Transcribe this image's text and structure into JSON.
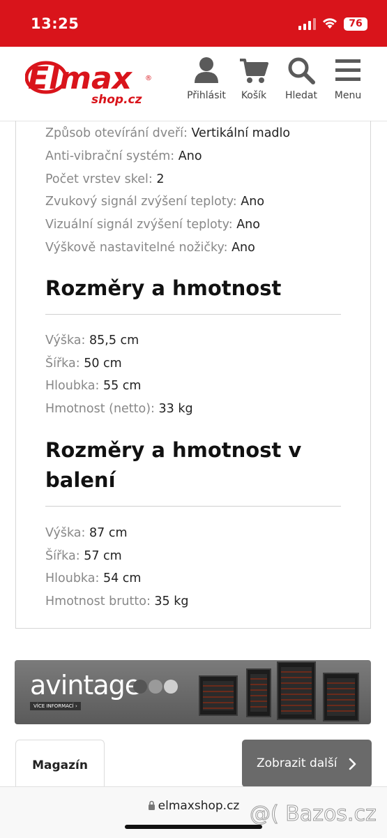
{
  "status_bar": {
    "time": "13:25",
    "battery": "76"
  },
  "header": {
    "logo_main": "Elmax",
    "logo_sub": "shop.cz",
    "logo_reg": "®",
    "nav": [
      {
        "label": "Přihlásit",
        "icon": "user-icon"
      },
      {
        "label": "Košík",
        "icon": "cart-icon"
      },
      {
        "label": "Hledat",
        "icon": "search-icon"
      },
      {
        "label": "Menu",
        "icon": "menu-icon"
      }
    ]
  },
  "specs_top": [
    {
      "key": "Způsob otevírání dveří:",
      "value": "Vertikální madlo"
    },
    {
      "key": "Anti-vibrační systém:",
      "value": "Ano"
    },
    {
      "key": "Počet vrstev skel:",
      "value": "2"
    },
    {
      "key": "Zvukový signál zvýšení teploty:",
      "value": "Ano"
    },
    {
      "key": "Vizuální signál zvýšení teploty:",
      "value": "Ano"
    },
    {
      "key": "Výškově nastavitelné nožičky:",
      "value": "Ano"
    }
  ],
  "section_dims": {
    "title": "Rozměry a hmotnost",
    "rows": [
      {
        "key": "Výška:",
        "value": "85,5 cm"
      },
      {
        "key": "Šířka:",
        "value": "50 cm"
      },
      {
        "key": "Hloubka:",
        "value": "55 cm"
      },
      {
        "key": "Hmotnost (netto):",
        "value": "33 kg"
      }
    ]
  },
  "section_pack": {
    "title": "Rozměry a hmotnost v balení",
    "rows": [
      {
        "key": "Výška:",
        "value": "87 cm"
      },
      {
        "key": "Šířka:",
        "value": "57 cm"
      },
      {
        "key": "Hloubka:",
        "value": "54 cm"
      },
      {
        "key": "Hmotnost brutto:",
        "value": "35 kg"
      }
    ]
  },
  "banner": {
    "brand": "avintage",
    "button": "VÍCE INFORMACÍ ›"
  },
  "tab_magazin": "Magazín",
  "more_button": "Zobrazit další",
  "browser": {
    "url": "elmaxshop.cz"
  },
  "watermark": "@( Bazos.cz",
  "colors": {
    "brand_red": "#d9141b",
    "button_gray": "#6a6a6a"
  }
}
